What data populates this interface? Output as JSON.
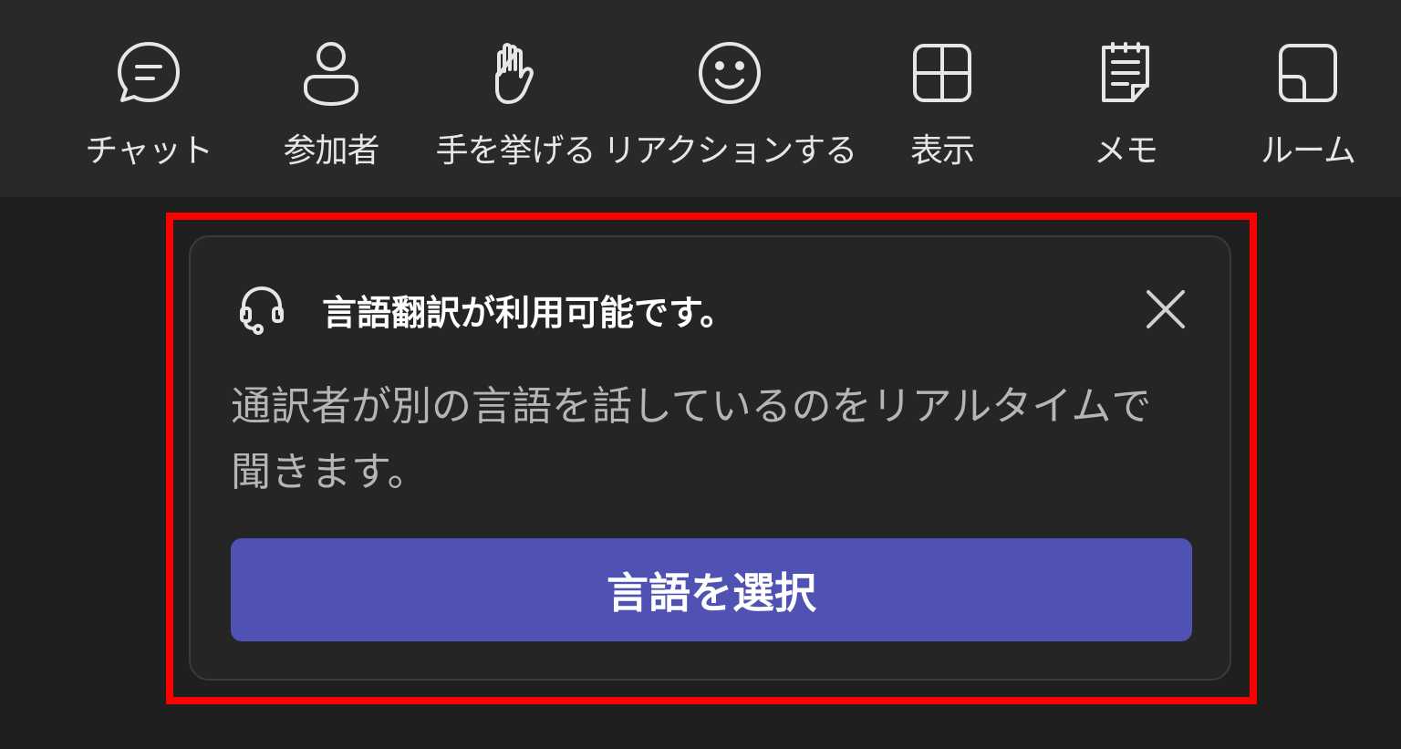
{
  "toolbar": {
    "items": [
      {
        "label": "チャット",
        "icon": "chat-icon"
      },
      {
        "label": "参加者",
        "icon": "person-icon"
      },
      {
        "label": "手を挙げる",
        "icon": "raise-hand-icon"
      },
      {
        "label": "リアクションする",
        "icon": "smiley-icon"
      },
      {
        "label": "表示",
        "icon": "grid-view-icon"
      },
      {
        "label": "メモ",
        "icon": "notes-icon"
      },
      {
        "label": "ルーム",
        "icon": "rooms-icon"
      }
    ]
  },
  "notice": {
    "icon": "headset-icon",
    "title": "言語翻訳が利用可能です。",
    "description": "通訳者が別の言語を話しているのをリアルタイムで聞きます。",
    "button_label": "言語を選択",
    "close_icon": "close-icon"
  },
  "colors": {
    "background": "#1f1f1f",
    "toolbar": "#292929",
    "card": "#252525",
    "primary": "#4f52b2",
    "highlight": "#ff0000"
  }
}
